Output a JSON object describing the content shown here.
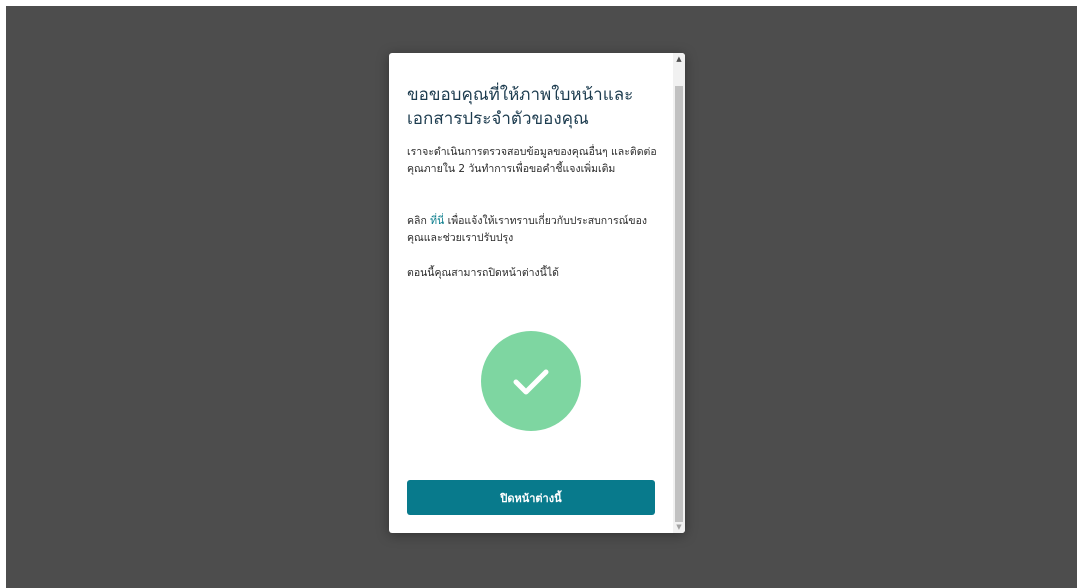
{
  "modal": {
    "title": "ขอขอบคุณที่ให้ภาพใบหน้าและเอกสารประจำตัวของคุณ",
    "paragraph1": "เราจะดำเนินการตรวจสอบข้อมูลของคุณอื่นๆ และติดต่อคุณภายใน 2 วันทำการเพื่อขอคำชี้แจงเพิ่มเติม",
    "paragraph2_prefix": "คลิก ",
    "paragraph2_link": "ที่นี่",
    "paragraph2_suffix": " เพื่อแจ้งให้เราทราบเกี่ยวกับประสบการณ์ของคุณและช่วยเราปรับปรุง",
    "paragraph3": "ตอนนี้คุณสามารถปิดหน้าต่างนี้ได้",
    "success_icon": "check-icon",
    "close_button_label": "ปิดหน้าต่างนี้"
  },
  "scrollbar": {
    "up_arrow": "▲",
    "down_arrow": "▼"
  },
  "colors": {
    "backdrop": "#4d4d4d",
    "title_text": "#1d3c4f",
    "link": "#0a7d8c",
    "success_circle": "#7ed6a1",
    "button": "#087a8c"
  }
}
